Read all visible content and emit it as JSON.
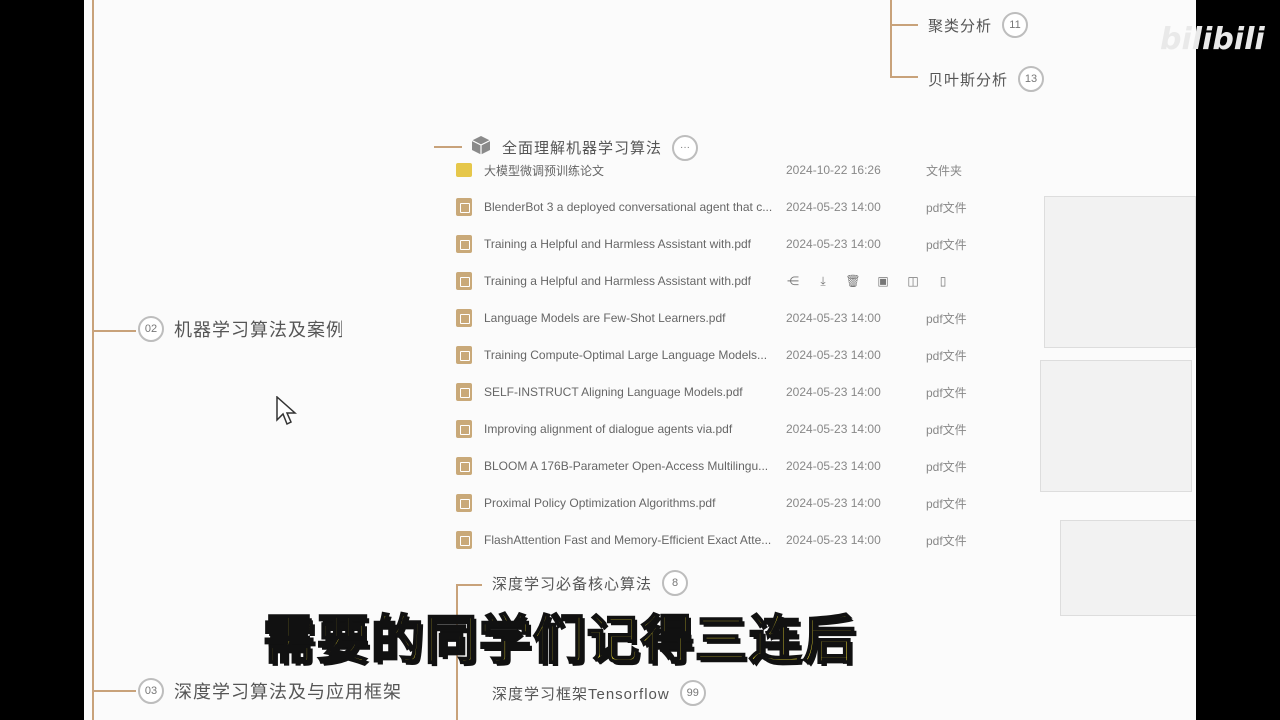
{
  "mindmap": {
    "nodes_top": [
      {
        "label": "聚类分析",
        "num": "11"
      },
      {
        "label": "贝叶斯分析",
        "num": "13"
      }
    ],
    "section02": {
      "num": "02",
      "label": "机器学习算法及案例"
    },
    "section03": {
      "num": "03",
      "label": "深度学习算法及与应用框架"
    },
    "folder_node": {
      "label": "全面理解机器学习算法",
      "more": "···"
    },
    "deep_nodes": [
      {
        "label": "深度学习必备核心算法",
        "num": "8"
      },
      {
        "label": "深度学习框架Tensorflow",
        "num": "99"
      }
    ]
  },
  "files": [
    {
      "name": "大模型微调预训练论文",
      "date": "2024-10-22 16:26",
      "type": "文件夹",
      "kind": "folder"
    },
    {
      "name": "BlenderBot 3 a deployed conversational agent that c...",
      "date": "2024-05-23 14:00",
      "type": "pdf文件",
      "kind": "pdf"
    },
    {
      "name": "Training a Helpful and Harmless Assistant with.pdf",
      "date": "2024-05-23 14:00",
      "type": "pdf文件",
      "kind": "pdf"
    },
    {
      "name": "Training a Helpful and Harmless Assistant with.pdf",
      "date": "",
      "type": "",
      "kind": "pdf",
      "hover": true
    },
    {
      "name": "Language Models are Few-Shot Learners.pdf",
      "date": "2024-05-23 14:00",
      "type": "pdf文件",
      "kind": "pdf"
    },
    {
      "name": "Training Compute-Optimal Large Language Models...",
      "date": "2024-05-23 14:00",
      "type": "pdf文件",
      "kind": "pdf"
    },
    {
      "name": "SELF-INSTRUCT Aligning Language Models.pdf",
      "date": "2024-05-23 14:00",
      "type": "pdf文件",
      "kind": "pdf"
    },
    {
      "name": "Improving alignment of dialogue agents via.pdf",
      "date": "2024-05-23 14:00",
      "type": "pdf文件",
      "kind": "pdf"
    },
    {
      "name": "BLOOM A 176B-Parameter Open-Access Multilingu...",
      "date": "2024-05-23 14:00",
      "type": "pdf文件",
      "kind": "pdf"
    },
    {
      "name": "Proximal Policy Optimization Algorithms.pdf",
      "date": "2024-05-23 14:00",
      "type": "pdf文件",
      "kind": "pdf"
    },
    {
      "name": "FlashAttention Fast and Memory-Efficient Exact Atte...",
      "date": "2024-05-23 14:00",
      "type": "pdf文件",
      "kind": "pdf"
    }
  ],
  "hover_actions": [
    "share-icon",
    "download-icon",
    "delete-icon",
    "rename-icon",
    "save-icon",
    "mobile-icon"
  ],
  "subtitle": "需要的同学们记得三连后",
  "watermark": "bilibili",
  "colors": {
    "branch": "#c8a27a",
    "subtitle": "#f3e135",
    "folder": "#e6c74a",
    "pdf": "#c9a979"
  }
}
